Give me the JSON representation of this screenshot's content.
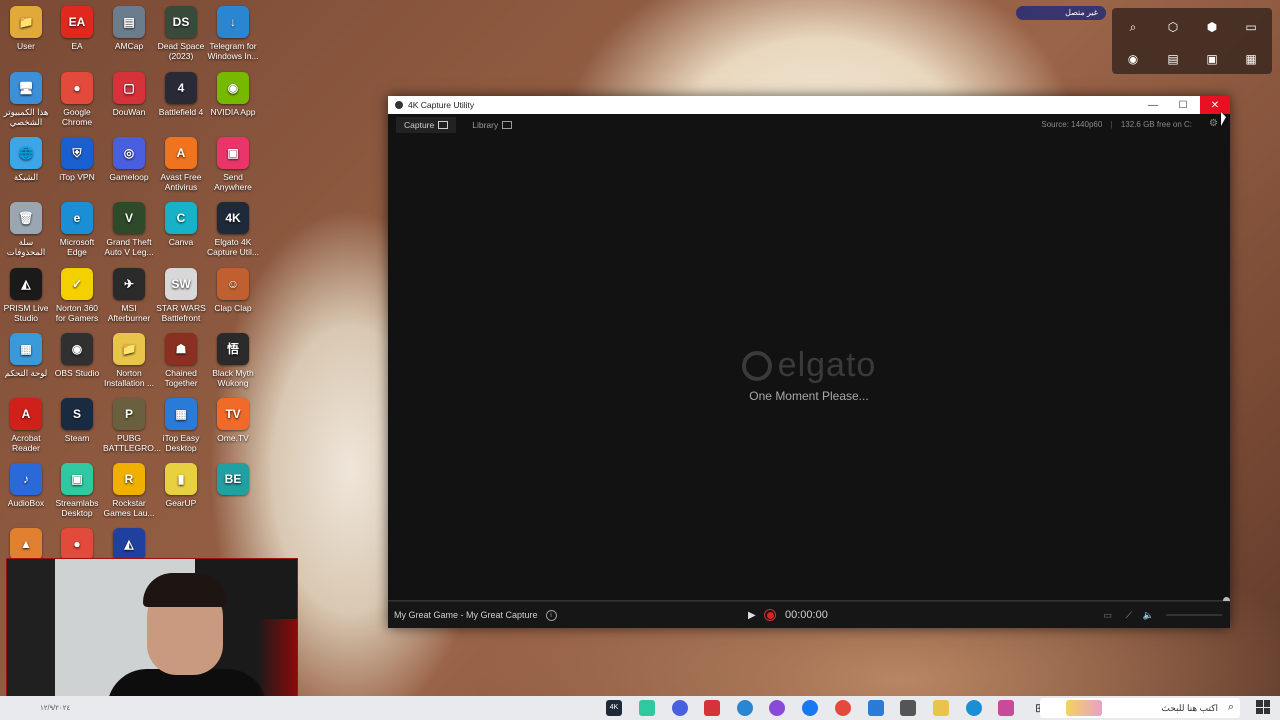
{
  "desktop": {
    "icons": [
      {
        "label": "User",
        "color": "#e0a93a",
        "glyph": "📁"
      },
      {
        "label": "EA",
        "color": "#e0281e",
        "glyph": "EA"
      },
      {
        "label": "AMCap",
        "color": "#6b7c8c",
        "glyph": "▤"
      },
      {
        "label": "Dead Space (2023)",
        "color": "#3a4a3a",
        "glyph": "DS"
      },
      {
        "label": "Telegram for Windows In...",
        "color": "#2a86d1",
        "glyph": "↓"
      },
      {
        "label": "هذا الكمبيوتر الشخصي",
        "color": "#3d8fd8",
        "glyph": "🖥"
      },
      {
        "label": "Google Chrome",
        "color": "#e24a3b",
        "glyph": "●"
      },
      {
        "label": "DouWan",
        "color": "#d6323a",
        "glyph": "▢"
      },
      {
        "label": "Battlefield 4",
        "color": "#2a2a36",
        "glyph": "4"
      },
      {
        "label": "NVIDIA App",
        "color": "#76b900",
        "glyph": "◉"
      },
      {
        "label": "الشبكة",
        "color": "#3da6e8",
        "glyph": "🌐"
      },
      {
        "label": "iTop VPN",
        "color": "#1a5fd0",
        "glyph": "⛨"
      },
      {
        "label": "Gameloop",
        "color": "#4a5ee0",
        "glyph": "◎"
      },
      {
        "label": "Avast Free Antivirus",
        "color": "#f07420",
        "glyph": "A"
      },
      {
        "label": "Send Anywhere",
        "color": "#e8356a",
        "glyph": "▣"
      },
      {
        "label": "سلة المحذوفات",
        "color": "#9aa6b2",
        "glyph": "🗑"
      },
      {
        "label": "Microsoft Edge",
        "color": "#1a8fd6",
        "glyph": "e"
      },
      {
        "label": "Grand Theft Auto V Leg...",
        "color": "#2e4a2a",
        "glyph": "V"
      },
      {
        "label": "Canva",
        "color": "#18b2c8",
        "glyph": "C"
      },
      {
        "label": "Elgato 4K Capture Util...",
        "color": "#1e2a3a",
        "glyph": "4K"
      },
      {
        "label": "PRISM Live Studio",
        "color": "#1a1a1a",
        "glyph": "◭"
      },
      {
        "label": "Norton 360 for Gamers",
        "color": "#f4d000",
        "glyph": "✓"
      },
      {
        "label": "MSI Afterburner",
        "color": "#2a2a2a",
        "glyph": "✈"
      },
      {
        "label": "STAR WARS Battlefront",
        "color": "#d8d8d8",
        "glyph": "SW"
      },
      {
        "label": "Clap Clap",
        "color": "#c06030",
        "glyph": "☺"
      },
      {
        "label": "لوحة التحكم",
        "color": "#3a9ad8",
        "glyph": "▦"
      },
      {
        "label": "OBS Studio",
        "color": "#303030",
        "glyph": "◉"
      },
      {
        "label": "Norton Installation ...",
        "color": "#e8c44a",
        "glyph": "📁"
      },
      {
        "label": "Chained Together",
        "color": "#8a3020",
        "glyph": "☗"
      },
      {
        "label": "Black Myth Wukong",
        "color": "#2a2a2a",
        "glyph": "悟"
      },
      {
        "label": "Acrobat Reader",
        "color": "#d0201a",
        "glyph": "A"
      },
      {
        "label": "Steam",
        "color": "#1a2a40",
        "glyph": "S"
      },
      {
        "label": "PUBG BATTLEGRO...",
        "color": "#6a6040",
        "glyph": "P"
      },
      {
        "label": "iTop Easy Desktop",
        "color": "#2a7ad8",
        "glyph": "▦"
      },
      {
        "label": "Ome.TV",
        "color": "#f06a2a",
        "glyph": "TV"
      },
      {
        "label": "AudioBox",
        "color": "#2a6ad8",
        "glyph": "♪"
      },
      {
        "label": "Streamlabs Desktop",
        "color": "#30c8a0",
        "glyph": "▣"
      },
      {
        "label": "Rockstar Games Lau...",
        "color": "#f0b000",
        "glyph": "R"
      },
      {
        "label": "GearUP",
        "color": "#e8d040",
        "glyph": "▮"
      },
      {
        "label": "",
        "color": "#20a0a0",
        "glyph": "BE"
      },
      {
        "label": "",
        "color": "#e08030",
        "glyph": "▲"
      },
      {
        "label": "",
        "color": "#e24a3b",
        "glyph": "●"
      },
      {
        "label": "",
        "color": "#2040a0",
        "glyph": "◭"
      }
    ]
  },
  "window": {
    "title": "4K Capture Utility",
    "tabs": [
      {
        "label": "Capture",
        "active": true
      },
      {
        "label": "Library",
        "active": false
      }
    ],
    "source_info": "Source: 1440p60",
    "free_space": "132.6 GB free on C:",
    "logo_text": "elgato",
    "loading_text": "One Moment Please...",
    "project_name": "My Great Game - My Great Capture",
    "timer": "00:00:00"
  },
  "top_panel": {
    "status_text": "غير متصل",
    "icons": [
      "search-icon",
      "cube-icon",
      "cube-outline-icon",
      "folder-icon",
      "camera-icon",
      "document-icon",
      "image-icon",
      "grid-icon"
    ]
  },
  "taskbar": {
    "search_placeholder": "اكتب هنا للبحث",
    "clock": "١٢/٩/٢٠٢٤"
  }
}
